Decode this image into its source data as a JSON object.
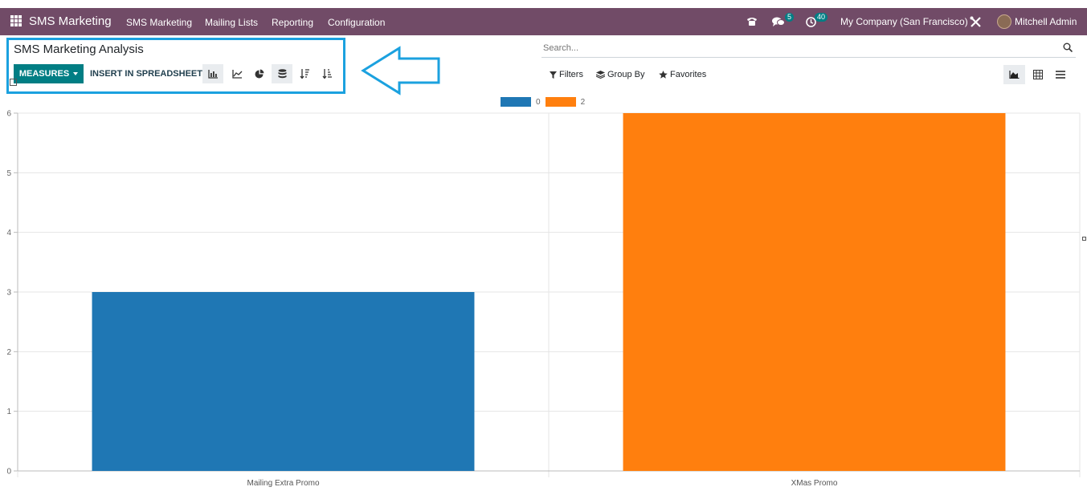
{
  "navbar": {
    "brand": "SMS Marketing",
    "menu": [
      "SMS Marketing",
      "Mailing Lists",
      "Reporting",
      "Configuration"
    ],
    "messages_count": "5",
    "activities_count": "40",
    "company": "My Company (San Francisco)",
    "user": "Mitchell Admin"
  },
  "control_panel": {
    "title": "SMS Marketing Analysis",
    "measures_label": "MEASURES",
    "spreadsheet_label": "INSERT IN SPREADSHEET",
    "search_placeholder": "Search...",
    "filters_label": "Filters",
    "groupby_label": "Group By",
    "favorites_label": "Favorites"
  },
  "colors": {
    "navbar": "#714b67",
    "primary": "#017e84",
    "series_0": "#1f77b4",
    "series_2": "#ff7f0e",
    "highlight": "#1ba1df"
  },
  "chart_data": {
    "type": "bar",
    "categories": [
      "Mailing Extra Promo",
      "XMas Promo"
    ],
    "series": [
      {
        "name": "0",
        "values": [
          3,
          null
        ],
        "color": "#1f77b4"
      },
      {
        "name": "2",
        "values": [
          null,
          6
        ],
        "color": "#ff7f0e"
      }
    ],
    "ylim": [
      0,
      6
    ],
    "yticks": [
      "0",
      "1",
      "2",
      "3",
      "4",
      "5",
      "6"
    ],
    "grid": true,
    "legend": "top-center"
  }
}
